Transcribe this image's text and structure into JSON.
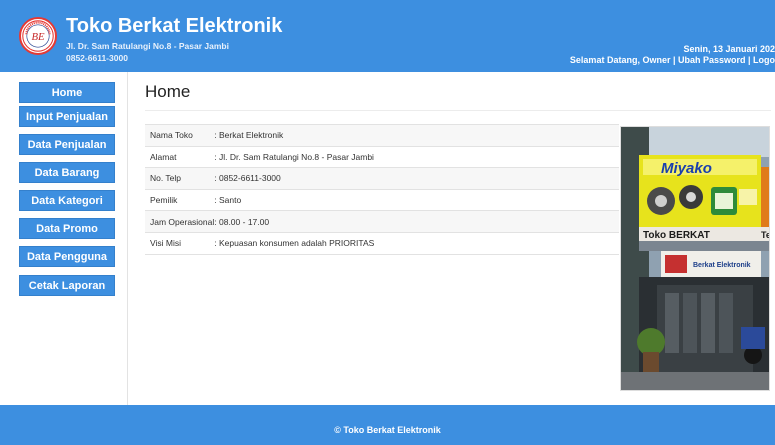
{
  "header": {
    "logo_text": "BE",
    "logo_ring_text": "BERKAT ELEKTRONIK",
    "title": "Toko Berkat Elektronik",
    "address": "Jl. Dr. Sam Ratulangi No.8 - Pasar Jambi",
    "phone": "0852-6611-3000",
    "date": "Senin, 13 Januari 202",
    "welcome": "Selamat Datang, Owner | Ubah Password | Logo"
  },
  "sidebar": {
    "items": [
      {
        "label": "Home"
      },
      {
        "label": "Input Penjualan"
      },
      {
        "label": "Data Penjualan"
      },
      {
        "label": "Data Barang"
      },
      {
        "label": "Data Kategori"
      },
      {
        "label": "Data Promo"
      },
      {
        "label": "Data Pengguna"
      },
      {
        "label": "Cetak Laporan"
      }
    ]
  },
  "main": {
    "title": "Home",
    "info": [
      {
        "label": "Nama Toko",
        "value": ": Berkat Elektronik"
      },
      {
        "label": "Alamat",
        "value": ": Jl. Dr. Sam Ratulangi No.8 - Pasar Jambi"
      },
      {
        "label": "No. Telp",
        "value": ": 0852-6611-3000"
      },
      {
        "label": "Pemilik",
        "value": ": Santo"
      },
      {
        "label": "Jam Operasional",
        "value": ": 08.00 - 17.00"
      },
      {
        "label": "Visi Misi",
        "value": ": Kepuasan konsumen adalah PRIORITAS"
      }
    ],
    "photo_signs": {
      "brand": "Miyako",
      "store": "Toko BERKAT",
      "store_suffix": "Te",
      "banner": "Berkat Elektronik"
    }
  },
  "footer": {
    "text": "© Toko Berkat Elektronik"
  },
  "colors": {
    "primary": "#3d8fe0",
    "logo_ring": "#e53935"
  }
}
